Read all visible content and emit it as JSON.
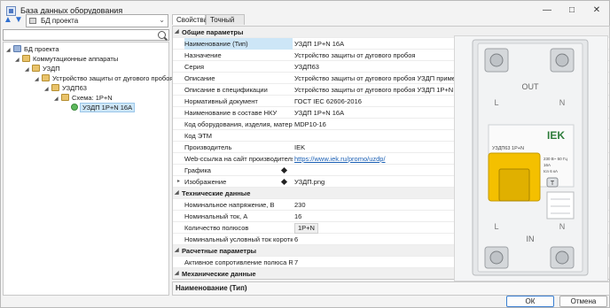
{
  "window": {
    "title": "База данных оборудования"
  },
  "left": {
    "combo_value": "БД проекта",
    "tree": [
      {
        "label": "БД проекта",
        "expanded": true,
        "icon": "db-icon"
      },
      {
        "label": "Коммутационные аппараты",
        "expanded": true,
        "icon": "folder-icon"
      },
      {
        "label": "УЗДП",
        "expanded": true,
        "icon": "folder-icon"
      },
      {
        "label": "Устройство защиты от дугового пробоя",
        "expanded": true,
        "icon": "folder-icon"
      },
      {
        "label": "УЗДП63",
        "expanded": true,
        "icon": "folder-icon"
      },
      {
        "label": "Схема: 1P+N",
        "expanded": true,
        "icon": "folder-icon"
      },
      {
        "label": "УЗДП 1P+N 16A",
        "expanded": false,
        "icon": "green-dot-icon",
        "selected": true
      }
    ]
  },
  "tabs": [
    "Свойства",
    "Точный вид"
  ],
  "grid": {
    "categories": {
      "general": "Общие параметры",
      "technical": "Технические данные",
      "calc": "Расчетные параметры",
      "mech": "Механические данные"
    },
    "general_rows": [
      {
        "name": "Наименование (Тип)",
        "value": "УЗДП 1P+N 16A"
      },
      {
        "name": "Назначение",
        "value": "Устройство защиты от дугового пробоя"
      },
      {
        "name": "Серия",
        "value": "УЗДП63"
      },
      {
        "name": "Описание",
        "value": "Устройство защиты от дугового пробоя УЗДП применяетс"
      },
      {
        "name": "Описание в спецификации",
        "value": "Устройство защиты от дугового пробоя УЗДП 1P+N 16A"
      },
      {
        "name": "Нормативный документ",
        "value": "ГОСТ IEC 62606-2016"
      },
      {
        "name": "Наименование в составе НКУ",
        "value": "УЗДП 1P+N 16A"
      },
      {
        "name": "Код оборудования, изделия, матери...",
        "value": "MDP10-16"
      },
      {
        "name": "Код ЭТМ",
        "value": ""
      },
      {
        "name": "Производитель",
        "value": "IEK"
      },
      {
        "name": "Web-ссылка на сайт производителя",
        "value": "https://www.iek.ru/promo/uzdp/"
      },
      {
        "name": "Графика",
        "value": ""
      },
      {
        "name": "Изображение",
        "value": "УЗДП.png"
      }
    ],
    "technical_rows": [
      {
        "name": "Номинальное напряжение, В",
        "value": "230"
      },
      {
        "name": "Номинальный ток, А",
        "value": "16"
      },
      {
        "name": "Количество полюсов",
        "value": "1P+N"
      },
      {
        "name": "Номинальный условный ток коротк...",
        "value": "6"
      }
    ],
    "calc_rows": [
      {
        "name": "Активное сопротивление полюса R,...",
        "value": "7"
      }
    ]
  },
  "description_label": "Наименование (Тип)",
  "device": {
    "brand": "IEK",
    "model_label": "УЗДП63 1P+N",
    "specs": [
      "230 В~ 50 Гц",
      "16A",
      "Icn 6 кА"
    ],
    "test_label": "T",
    "top_label": "OUT",
    "bottom_label": "IN",
    "left_label": "L",
    "right_label": "N",
    "body_color": "#f2f3f4",
    "handle_color": "#f4c000",
    "brand_color": "#2e7d3b"
  },
  "buttons": {
    "ok": "ОК",
    "cancel": "Отмена"
  }
}
